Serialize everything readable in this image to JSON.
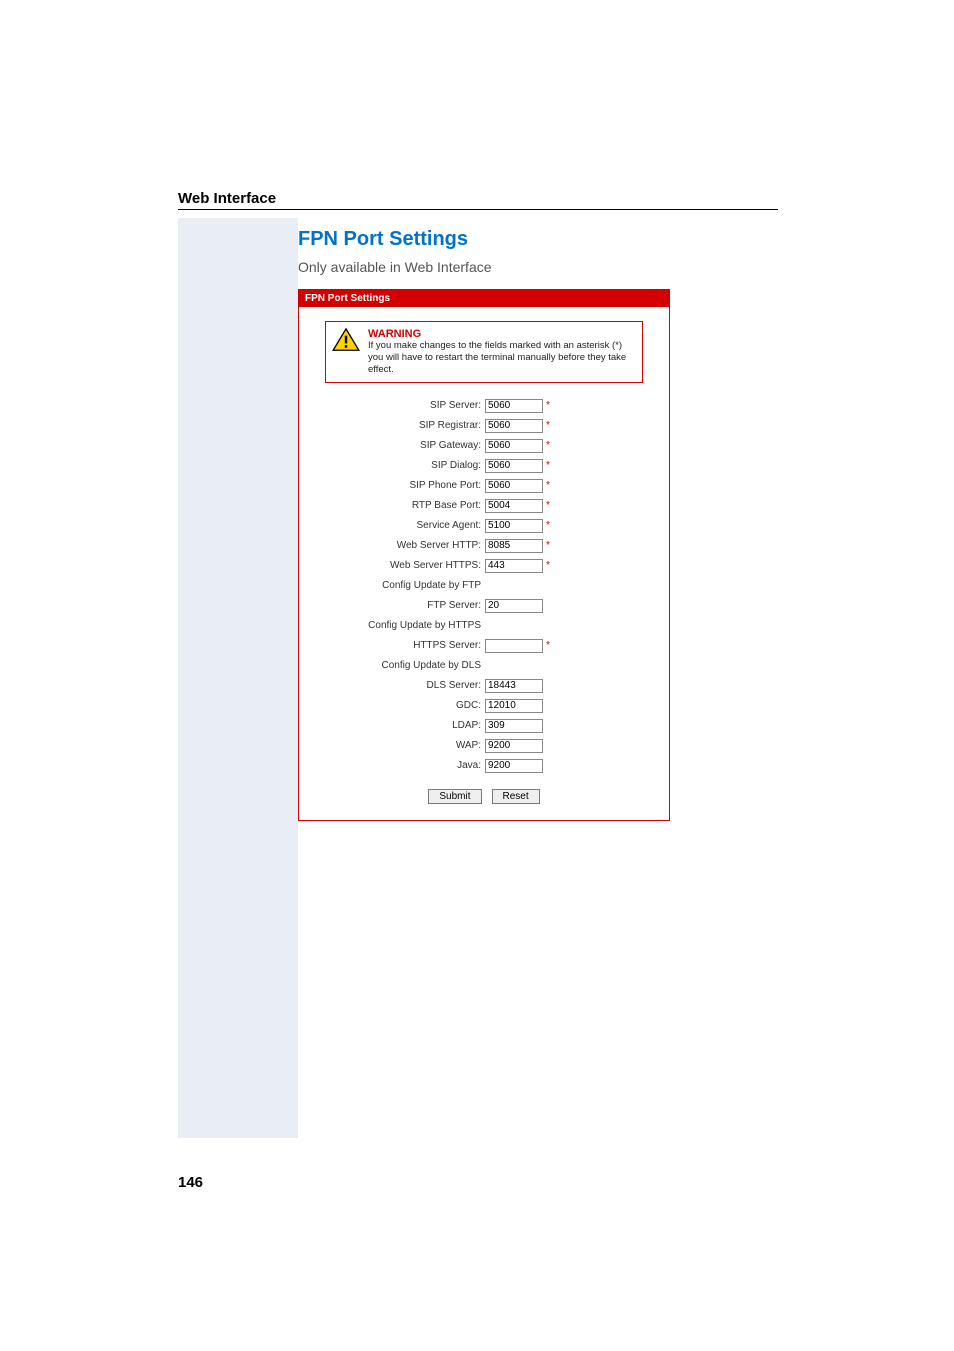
{
  "breadcrumb": "Web Interface",
  "page_number": "146",
  "heading": "FPN Port Settings",
  "subheading": "Only available in Web Interface",
  "panel": {
    "title": "FPN Port Settings",
    "warning": {
      "head": "WARNING",
      "body": "If you make changes to the fields marked with an asterisk (*) you will have to restart the terminal manually before they take effect."
    },
    "fields": {
      "sip_server": {
        "label": "SIP Server:",
        "value": "5060",
        "ast": true
      },
      "sip_registrar": {
        "label": "SIP Registrar:",
        "value": "5060",
        "ast": true
      },
      "sip_gateway": {
        "label": "SIP Gateway:",
        "value": "5060",
        "ast": true
      },
      "sip_dialog": {
        "label": "SIP Dialog:",
        "value": "5060",
        "ast": true
      },
      "sip_phone_port": {
        "label": "SIP Phone Port:",
        "value": "5060",
        "ast": true
      },
      "rtp_base_port": {
        "label": "RTP Base Port:",
        "value": "5004",
        "ast": true
      },
      "service_agent": {
        "label": "Service Agent:",
        "value": "5100",
        "ast": true
      },
      "web_http": {
        "label": "Web Server HTTP:",
        "value": "8085",
        "ast": true
      },
      "web_https": {
        "label": "Web Server HTTPS:",
        "value": "443",
        "ast": true
      },
      "group_ftp": {
        "label": "Config Update by FTP"
      },
      "ftp_server": {
        "label": "FTP Server:",
        "value": "20",
        "ast": false
      },
      "group_https": {
        "label": "Config Update by HTTPS"
      },
      "https_server": {
        "label": "HTTPS Server:",
        "value": "",
        "ast": true
      },
      "group_dls": {
        "label": "Config Update by DLS"
      },
      "dls_server": {
        "label": "DLS Server:",
        "value": "18443",
        "ast": false
      },
      "gdc": {
        "label": "GDC:",
        "value": "12010",
        "ast": false
      },
      "ldap": {
        "label": "LDAP:",
        "value": "309",
        "ast": false
      },
      "wap": {
        "label": "WAP:",
        "value": "9200",
        "ast": false
      },
      "java": {
        "label": "Java:",
        "value": "9200",
        "ast": false
      }
    },
    "buttons": {
      "submit": "Submit",
      "reset": "Reset"
    }
  }
}
